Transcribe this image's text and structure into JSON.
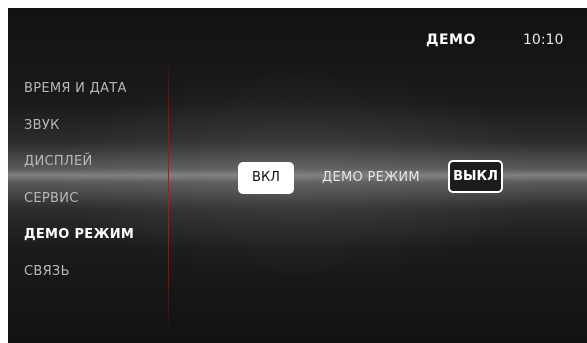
{
  "header": {
    "title": "ДЕМО",
    "clock": "10:10"
  },
  "sidebar": {
    "items": [
      {
        "label": "ВРЕМЯ И ДАТА",
        "active": false
      },
      {
        "label": "ЗВУК",
        "active": false
      },
      {
        "label": "ДИСПЛЕЙ",
        "active": false
      },
      {
        "label": "СЕРВИС",
        "active": false
      },
      {
        "label": "ДЕМО РЕЖИМ",
        "active": true
      },
      {
        "label": "СВЯЗЬ",
        "active": false
      }
    ]
  },
  "main": {
    "on_label": "ВКЛ",
    "mode_label": "ДЕМО РЕЖИМ",
    "off_label": "ВЫКЛ",
    "selected": "ВЫКЛ"
  },
  "colors": {
    "background": "#121212",
    "text": "#ffffff",
    "inactive_text": "#b8b8b8",
    "divider": "#8a2a2a"
  }
}
